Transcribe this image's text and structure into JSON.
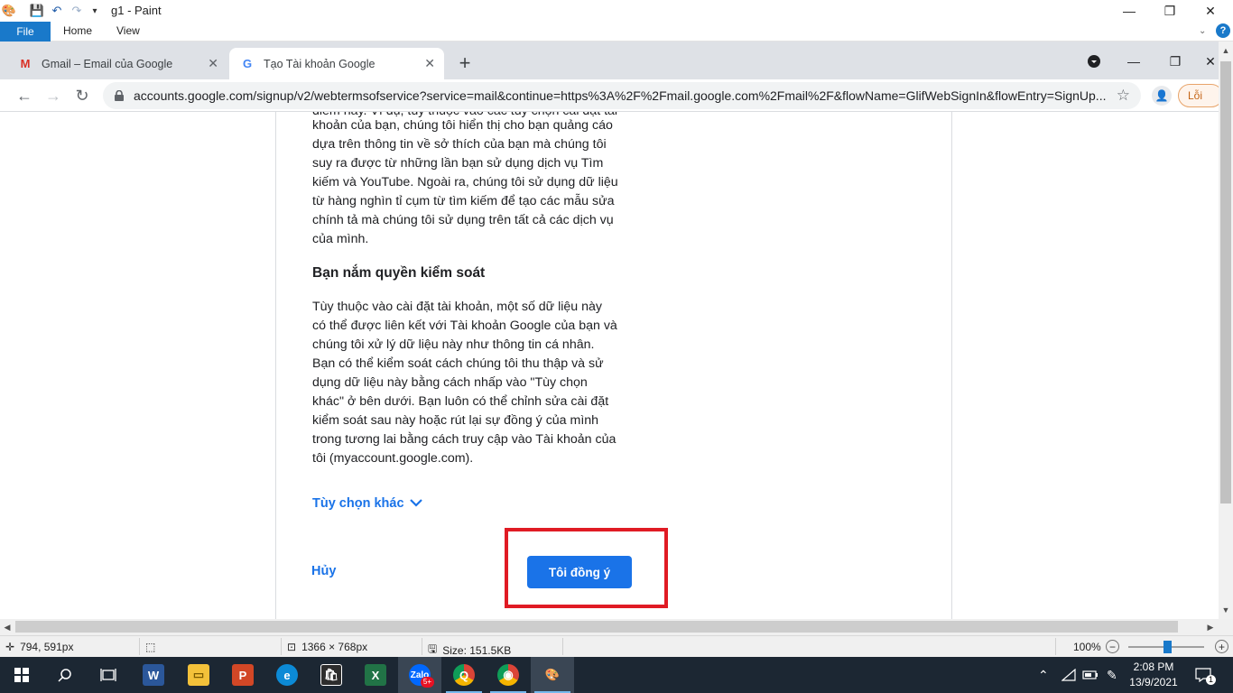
{
  "paint": {
    "title": "g1 - Paint",
    "tabs": {
      "file": "File",
      "home": "Home",
      "view": "View"
    },
    "window_controls": {
      "minimize": "—",
      "restore": "❐",
      "close": "✕"
    },
    "help": "?",
    "status": {
      "cursor_pos": "794, 591px",
      "canvas_size": "1366 × 768px",
      "file_size": "Size: 151.5KB",
      "zoom": "100%"
    }
  },
  "chrome": {
    "tabs": [
      {
        "title": "Gmail – Email của Google",
        "icon": "gmail-icon"
      },
      {
        "title": "Tạo Tài khoản Google",
        "icon": "google-icon"
      }
    ],
    "url": "accounts.google.com/signup/v2/webtermsofservice?service=mail&continue=https%3A%2F%2Fmail.google.com%2Fmail%2F&flowName=GlifWebSignIn&flowEntry=SignUp...",
    "error_chip": "Lỗi"
  },
  "content": {
    "top_paragraph_line0": "điểm này. Vì dụ, tùy thuộc vào các tùy chọn cài đặt tài",
    "top_paragraph": [
      "khoản của bạn, chúng tôi hiển thị cho bạn quảng cáo",
      "dựa trên thông tin về sở thích của bạn mà chúng tôi",
      "suy ra được từ những lần bạn sử dụng dịch vụ Tìm",
      "kiếm và YouTube. Ngoài ra, chúng tôi sử dụng dữ liệu",
      "từ hàng nghìn tỉ cụm từ tìm kiếm để tạo các mẫu sửa",
      "chính tả mà chúng tôi sử dụng trên tất cả các dịch vụ",
      "của mình."
    ],
    "heading": "Bạn nắm quyền kiểm soát",
    "control_paragraph": [
      "Tùy thuộc vào cài đặt tài khoản, một số dữ liệu này",
      "có thể được liên kết với Tài khoản Google của bạn và",
      "chúng tôi xử lý dữ liệu này như thông tin cá nhân.",
      "Bạn có thể kiểm soát cách chúng tôi thu thập và sử",
      "dụng dữ liệu này bằng cách nhấp vào \"Tùy chọn",
      "khác\" ở bên dưới. Bạn luôn có thể chỉnh sửa cài đặt",
      "kiểm soát sau này hoặc rút lại sự đồng ý của mình",
      "trong tương lai bằng cách truy cập vào Tài khoản của",
      "tôi (myaccount.google.com)."
    ],
    "more_options": "Tùy chọn khác",
    "cancel": "Hủy",
    "agree": "Tôi đồng ý"
  },
  "taskbar": {
    "time": "2:08 PM",
    "date": "13/9/2021",
    "notification_count": "1",
    "zalo_badge": "5+"
  },
  "colors": {
    "accent": "#1a73e8",
    "highlight": "#e01b24",
    "paint_blue": "#1979ca",
    "taskbar": "#1c2733"
  }
}
